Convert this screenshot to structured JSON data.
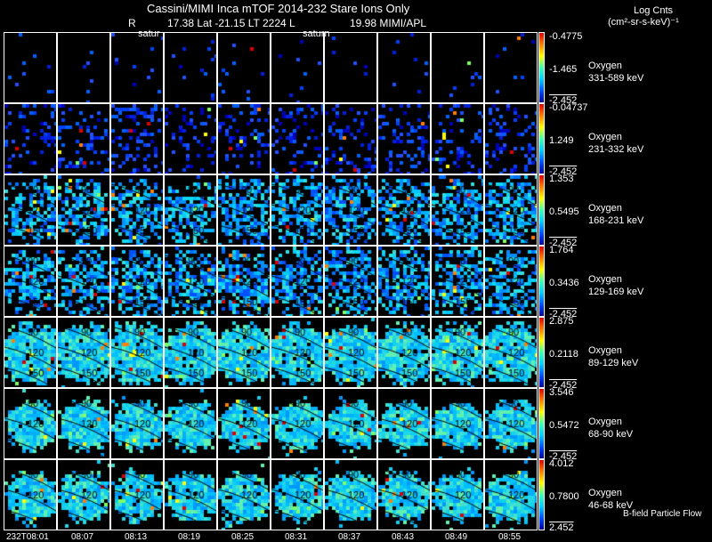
{
  "header": {
    "title": "Cassini/MIMI Inca mTOF  2014-232   Stare   Ions Only",
    "subtitle_r": "R",
    "subtitle_mid": "17.38 Lat -21.15 LT 2224 L",
    "subtitle_right": "19.98  MIMI/APL",
    "overlay_1": "satur",
    "overlay_2": "saturn",
    "units_line1": "Log Cnts",
    "units_line2": "(cm²-sr-s-keV)⁻¹"
  },
  "chart_data": {
    "type": "heatmap",
    "times": [
      "232T08:01",
      "08:07",
      "08:13",
      "08:19",
      "08:25",
      "08:31",
      "08:37",
      "08:43",
      "08:49",
      "08:55"
    ],
    "contour_labels": [
      "90",
      "120",
      "150"
    ],
    "rows": [
      {
        "species": "Oxygen",
        "energy": "331-589 keV",
        "cmax": "-0.4775",
        "cmid": "-1.465",
        "cmin": "-2.452"
      },
      {
        "species": "Oxygen",
        "energy": "231-332 keV",
        "cmax": "-0.04737",
        "cmid": "1.249",
        "cmin": "-2.452"
      },
      {
        "species": "Oxygen",
        "energy": "168-231 keV",
        "cmax": "1.353",
        "cmid": "0.5495",
        "cmin": "-2.452"
      },
      {
        "species": "Oxygen",
        "energy": "129-169 keV",
        "cmax": "1.764",
        "cmid": "0.3436",
        "cmin": "-2.452"
      },
      {
        "species": "Oxygen",
        "energy": "89-129 keV",
        "cmax": "2.875",
        "cmid": "0.2118",
        "cmin": "-2.452"
      },
      {
        "species": "Oxygen",
        "energy": "68-90 keV",
        "cmax": "3.546",
        "cmid": "0.5472",
        "cmin": "-2.452"
      },
      {
        "species": "Oxygen",
        "energy": "46-68 keV",
        "cmax": "4.012",
        "cmid": "0.7800",
        "cmin": "2.452"
      }
    ],
    "colorscale": [
      "#0000a0",
      "#0050ff",
      "#00d0ff",
      "#40ffb0",
      "#ffff00",
      "#ff8000",
      "#e00000"
    ]
  },
  "footer": {
    "legend": "B-field Particle Flow"
  }
}
